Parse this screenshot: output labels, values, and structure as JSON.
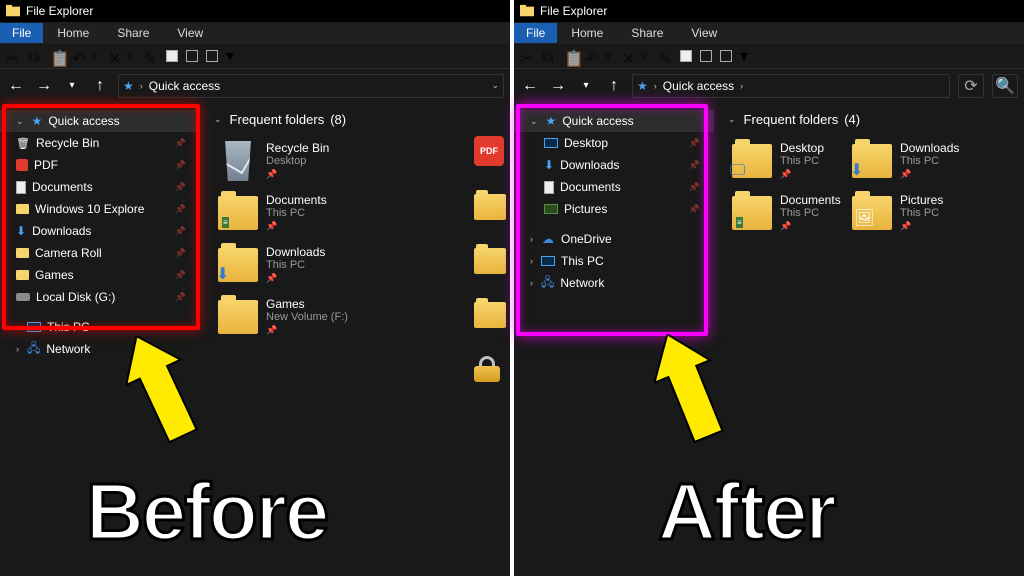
{
  "window_title": "File Explorer",
  "menu": {
    "file": "File",
    "home": "Home",
    "share": "Share",
    "view": "View"
  },
  "nav": {
    "quick_access": "Quick access"
  },
  "before": {
    "heading_prefix": "Frequent folders",
    "heading_count": "(8)",
    "tree": [
      {
        "name": "Quick access",
        "selected": true,
        "pinned": false,
        "kind": "quick"
      },
      {
        "name": "Recycle Bin",
        "selected": false,
        "pinned": true,
        "kind": "bin"
      },
      {
        "name": "PDF",
        "selected": false,
        "pinned": true,
        "kind": "pdf"
      },
      {
        "name": "Documents",
        "selected": false,
        "pinned": true,
        "kind": "doc"
      },
      {
        "name": "Windows 10 Explore",
        "selected": false,
        "pinned": true,
        "kind": "folder"
      },
      {
        "name": "Downloads",
        "selected": false,
        "pinned": true,
        "kind": "down"
      },
      {
        "name": "Camera Roll",
        "selected": false,
        "pinned": true,
        "kind": "folder"
      },
      {
        "name": "Games",
        "selected": false,
        "pinned": true,
        "kind": "folder"
      },
      {
        "name": "Local Disk (G:)",
        "selected": false,
        "pinned": true,
        "kind": "drive"
      }
    ],
    "extra_tree": [
      {
        "name": "This PC",
        "kind": "pc"
      },
      {
        "name": "Network",
        "kind": "net"
      }
    ],
    "folders": [
      {
        "name": "Recycle Bin",
        "sub": "Desktop",
        "icon": "recycle"
      },
      {
        "name": "Documents",
        "sub": "This PC",
        "icon": "folder-doc"
      },
      {
        "name": "Downloads",
        "sub": "This PC",
        "icon": "folder-down"
      },
      {
        "name": "Games",
        "sub": "New Volume (F:)",
        "icon": "folder"
      }
    ],
    "side_icons": [
      "pdf",
      "folder",
      "folder",
      "folder",
      "lock"
    ]
  },
  "after": {
    "heading_prefix": "Frequent folders",
    "heading_count": "(4)",
    "tree": [
      {
        "name": "Quick access",
        "selected": true,
        "pinned": false,
        "kind": "quick"
      },
      {
        "name": "Desktop",
        "selected": false,
        "pinned": true,
        "kind": "monitor",
        "sub": true
      },
      {
        "name": "Downloads",
        "selected": false,
        "pinned": true,
        "kind": "down",
        "sub": true
      },
      {
        "name": "Documents",
        "selected": false,
        "pinned": true,
        "kind": "doc",
        "sub": true
      },
      {
        "name": "Pictures",
        "selected": false,
        "pinned": true,
        "kind": "pic",
        "sub": true
      }
    ],
    "extra_tree": [
      {
        "name": "OneDrive",
        "kind": "cloud"
      },
      {
        "name": "This PC",
        "kind": "pc"
      },
      {
        "name": "Network",
        "kind": "net"
      }
    ],
    "folders": [
      {
        "name": "Desktop",
        "sub": "This PC",
        "icon": "folder-desktop"
      },
      {
        "name": "Downloads",
        "sub": "This PC",
        "icon": "folder-down"
      },
      {
        "name": "Documents",
        "sub": "This PC",
        "icon": "folder-doc"
      },
      {
        "name": "Pictures",
        "sub": "This PC",
        "icon": "folder-pic"
      }
    ]
  },
  "labels": {
    "before": "Before",
    "after": "After"
  }
}
